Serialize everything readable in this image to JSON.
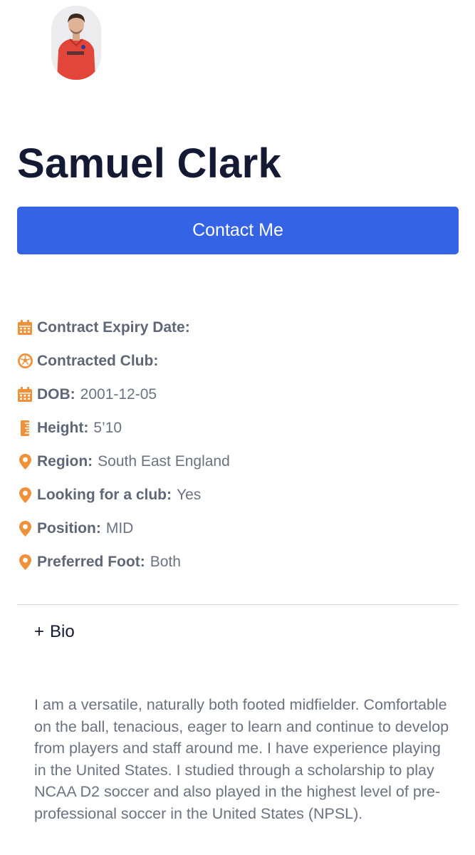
{
  "profile": {
    "name": "Samuel Clark",
    "contact_label": "Contact Me"
  },
  "details": [
    {
      "icon": "calendar-icon",
      "label": "Contract Expiry Date:",
      "value": ""
    },
    {
      "icon": "soccer-ball-icon",
      "label": "Contracted Club:",
      "value": ""
    },
    {
      "icon": "calendar-icon",
      "label": "DOB:",
      "value": "2001-12-05"
    },
    {
      "icon": "ruler-icon",
      "label": "Height:",
      "value": "5’10"
    },
    {
      "icon": "map-pin-icon",
      "label": "Region:",
      "value": "South East England"
    },
    {
      "icon": "map-pin-icon",
      "label": "Looking for a club:",
      "value": "Yes"
    },
    {
      "icon": "map-pin-icon",
      "label": "Position:",
      "value": "MID"
    },
    {
      "icon": "map-pin-icon",
      "label": "Preferred Foot:",
      "value": "Both"
    }
  ],
  "bio": {
    "toggle_symbol": "+",
    "toggle_label": "Bio",
    "text": "I am a versatile, naturally both footed midfielder. Comfortable on the ball, tenacious, eager to learn and continue to develop from players and staff around me. I have experience playing in the United States. I studied through a scholarship to play NCAA D2 soccer and also played in the highest level of pre-professional soccer in the United States (NPSL)."
  },
  "colors": {
    "accent_button": "#3563e6",
    "icon_orange": "#f0913a",
    "name_text": "#141a33",
    "muted_text": "#6b7280"
  }
}
